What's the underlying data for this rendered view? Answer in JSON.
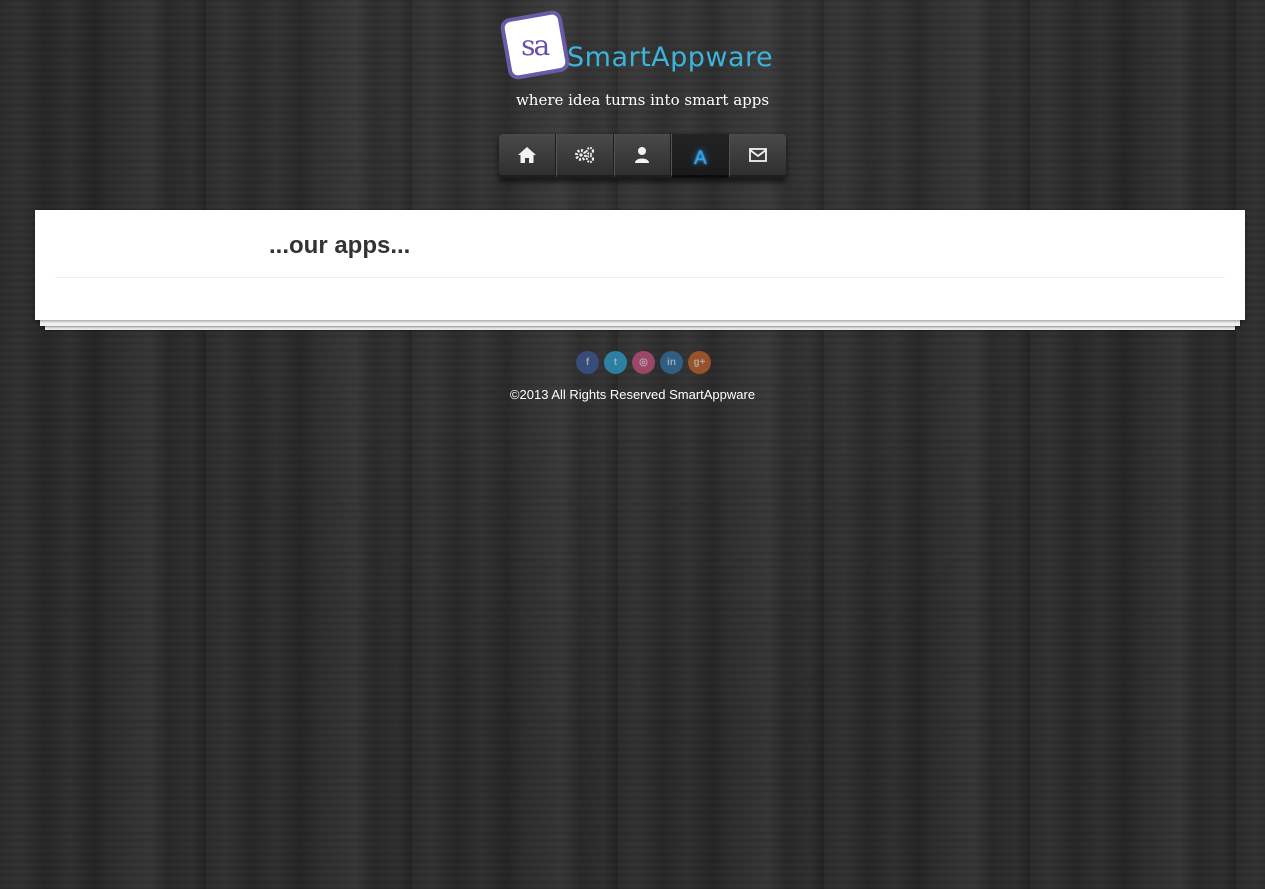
{
  "brand": {
    "logo_mark": "sa",
    "name": "SmartAppware",
    "tagline": "where idea turns into smart apps",
    "name_color": "#3cb4dc"
  },
  "nav": {
    "items": [
      {
        "icon": "home-icon",
        "active": false
      },
      {
        "icon": "gears-icon",
        "active": false
      },
      {
        "icon": "user-icon",
        "active": false
      },
      {
        "icon": "apps-icon",
        "glyph": "A",
        "active": true
      },
      {
        "icon": "envelope-icon",
        "active": false
      }
    ],
    "active_color": "#2aa9e8"
  },
  "main": {
    "title": "...our apps..."
  },
  "social": {
    "items": [
      {
        "icon": "facebook-icon",
        "glyph": "f",
        "color": "#3b5998"
      },
      {
        "icon": "twitter-icon",
        "glyph": "t",
        "color": "#2ba3d4"
      },
      {
        "icon": "dribbble-icon",
        "glyph": "◎",
        "color": "#c8507f"
      },
      {
        "icon": "linkedin-icon",
        "glyph": "in",
        "color": "#2f73a8"
      },
      {
        "icon": "googleplus-icon",
        "glyph": "g+",
        "color": "#c4622a"
      }
    ]
  },
  "footer": {
    "copyright": "©2013 All Rights Reserved SmartAppware"
  }
}
